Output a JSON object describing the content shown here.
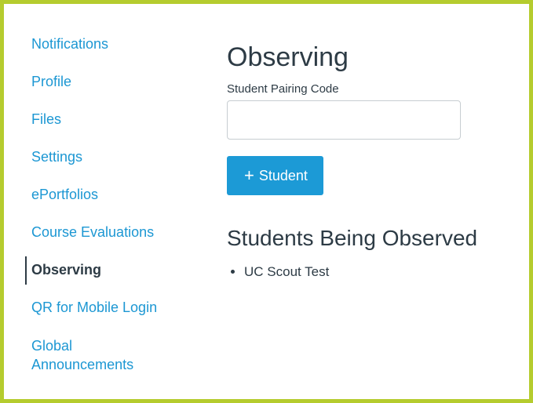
{
  "sidebar": {
    "items": [
      {
        "label": "Notifications",
        "active": false
      },
      {
        "label": "Profile",
        "active": false
      },
      {
        "label": "Files",
        "active": false
      },
      {
        "label": "Settings",
        "active": false
      },
      {
        "label": "ePortfolios",
        "active": false
      },
      {
        "label": "Course Evaluations",
        "active": false
      },
      {
        "label": "Observing",
        "active": true
      },
      {
        "label": "QR for Mobile Login",
        "active": false
      },
      {
        "label": "Global Announcements",
        "active": false
      }
    ]
  },
  "main": {
    "title": "Observing",
    "pairing_code": {
      "label": "Student Pairing Code",
      "value": "",
      "placeholder": ""
    },
    "add_button": {
      "icon": "plus-icon",
      "label": "Student"
    },
    "observed_heading": "Students Being Observed",
    "observed_students": [
      "UC Scout Test"
    ]
  },
  "colors": {
    "frame_border": "#b5cc2e",
    "link": "#1c97d3",
    "text": "#2d3b45",
    "button": "#1c9ad6"
  }
}
